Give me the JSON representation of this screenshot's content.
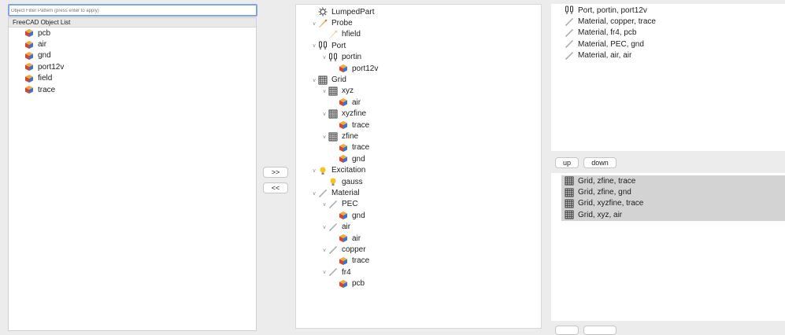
{
  "filter": {
    "placeholder": "Object Filter Pattern (press enter to apply)"
  },
  "object_list": {
    "header": "FreeCAD Object List",
    "items": [
      "pcb",
      "air",
      "gnd",
      "port12v",
      "field",
      "trace"
    ]
  },
  "transfer": {
    "add_label": ">>",
    "remove_label": "<<"
  },
  "tree": {
    "rows": [
      {
        "label": "LumpedPart",
        "icon": "gear-icon",
        "depth": 0,
        "chevron": false
      },
      {
        "label": "Probe",
        "icon": "probe-icon",
        "depth": 0,
        "chevron": true
      },
      {
        "label": "hfield",
        "icon": "probe-icon-faded",
        "depth": 1,
        "chevron": false
      },
      {
        "label": "Port",
        "icon": "port-icon",
        "depth": 0,
        "chevron": true
      },
      {
        "label": "portin",
        "icon": "port-icon",
        "depth": 1,
        "chevron": true
      },
      {
        "label": "port12v",
        "icon": "part-icon",
        "depth": 2,
        "chevron": false
      },
      {
        "label": "Grid",
        "icon": "grid-icon",
        "depth": 0,
        "chevron": true
      },
      {
        "label": "xyz",
        "icon": "grid-icon",
        "depth": 1,
        "chevron": true
      },
      {
        "label": "air",
        "icon": "part-icon",
        "depth": 2,
        "chevron": false
      },
      {
        "label": "xyzfine",
        "icon": "grid-icon",
        "depth": 1,
        "chevron": true
      },
      {
        "label": "trace",
        "icon": "part-icon",
        "depth": 2,
        "chevron": false
      },
      {
        "label": "zfine",
        "icon": "grid-icon",
        "depth": 1,
        "chevron": true
      },
      {
        "label": "trace",
        "icon": "part-icon",
        "depth": 2,
        "chevron": false
      },
      {
        "label": "gnd",
        "icon": "part-icon",
        "depth": 2,
        "chevron": false
      },
      {
        "label": "Excitation",
        "icon": "bulb-icon",
        "depth": 0,
        "chevron": true
      },
      {
        "label": "gauss",
        "icon": "bulb-icon",
        "depth": 1,
        "chevron": false
      },
      {
        "label": "Material",
        "icon": "material-icon",
        "depth": 0,
        "chevron": true
      },
      {
        "label": "PEC",
        "icon": "material-icon",
        "depth": 1,
        "chevron": true
      },
      {
        "label": "gnd",
        "icon": "part-icon",
        "depth": 2,
        "chevron": false
      },
      {
        "label": "air",
        "icon": "material-icon",
        "depth": 1,
        "chevron": true
      },
      {
        "label": "air",
        "icon": "part-icon",
        "depth": 2,
        "chevron": false
      },
      {
        "label": "copper",
        "icon": "material-icon",
        "depth": 1,
        "chevron": true
      },
      {
        "label": "trace",
        "icon": "part-icon",
        "depth": 2,
        "chevron": false
      },
      {
        "label": "fr4",
        "icon": "material-icon",
        "depth": 1,
        "chevron": true
      },
      {
        "label": "pcb",
        "icon": "part-icon",
        "depth": 2,
        "chevron": false
      }
    ]
  },
  "assignments": {
    "items": [
      {
        "label": "Port, portin, port12v",
        "icon": "port-icon"
      },
      {
        "label": "Material, copper, trace",
        "icon": "material-icon"
      },
      {
        "label": "Material, fr4, pcb",
        "icon": "material-icon"
      },
      {
        "label": "Material, PEC, gnd",
        "icon": "material-icon"
      },
      {
        "label": "Material, air, air",
        "icon": "material-icon"
      }
    ]
  },
  "priority_buttons": {
    "up_label": "up",
    "down_label": "down"
  },
  "grid_priority": {
    "items": [
      {
        "label": "Grid, zfine, trace",
        "icon": "grid-icon"
      },
      {
        "label": "Grid, zfine, gnd",
        "icon": "grid-icon"
      },
      {
        "label": "Grid, xyzfine, trace",
        "icon": "grid-icon"
      },
      {
        "label": "Grid, xyz, air",
        "icon": "grid-icon"
      }
    ]
  }
}
